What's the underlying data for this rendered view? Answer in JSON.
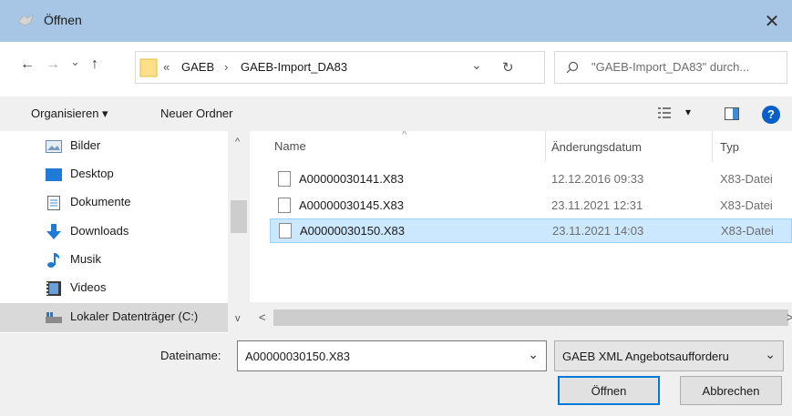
{
  "window": {
    "title": "Öffnen",
    "close_glyph": "✕"
  },
  "nav": {
    "back_glyph": "←",
    "forward_glyph": "→",
    "recent_glyph": "⌄",
    "up_glyph": "↑",
    "breadcrumb_overflow": "«",
    "breadcrumb": [
      "GAEB",
      "GAEB-Import_DA83"
    ],
    "breadcrumb_sep": "›",
    "address_dropdown_glyph": "⌄",
    "refresh_glyph": "↻",
    "search_placeholder": "\"GAEB-Import_DA83\" durch..."
  },
  "toolbar": {
    "organize_label": "Organisieren ▾",
    "new_folder_label": "Neuer Ordner",
    "view_glyph": "▾",
    "help_glyph": "?"
  },
  "sidebar": {
    "items": [
      {
        "label": "Bilder",
        "icon": "pictures-icon"
      },
      {
        "label": "Desktop",
        "icon": "desktop-icon"
      },
      {
        "label": "Dokumente",
        "icon": "documents-icon"
      },
      {
        "label": "Downloads",
        "icon": "downloads-icon"
      },
      {
        "label": "Musik",
        "icon": "music-icon"
      },
      {
        "label": "Videos",
        "icon": "videos-icon"
      },
      {
        "label": "Lokaler Datenträger (C:)",
        "icon": "drive-icon"
      }
    ],
    "scroll_up_glyph": "^",
    "scroll_down_glyph": "v"
  },
  "files": {
    "columns": {
      "name": "Name",
      "date": "Änderungsdatum",
      "type": "Typ"
    },
    "sort_glyph": "^",
    "rows": [
      {
        "name": "A00000030141.X83",
        "date": "12.12.2016 09:33",
        "type": "X83-Datei"
      },
      {
        "name": "A00000030145.X83",
        "date": "23.11.2021 12:31",
        "type": "X83-Datei"
      },
      {
        "name": "A00000030150.X83",
        "date": "23.11.2021 14:03",
        "type": "X83-Datei"
      }
    ],
    "selected_index": 2,
    "hscroll_left_glyph": "<",
    "hscroll_right_glyph": ">"
  },
  "bottom": {
    "filename_label": "Dateiname:",
    "filename_value": "A00000030150.X83",
    "filename_dropdown_glyph": "⌄",
    "filetype_value": "GAEB XML Angebotsaufforderu",
    "filetype_dropdown_glyph": "⌄",
    "open_label": "Öffnen",
    "cancel_label": "Abbrechen"
  },
  "colors": {
    "titlebar": "#a7c6e5",
    "selection": "#cce8ff",
    "accent": "#0078d7"
  }
}
